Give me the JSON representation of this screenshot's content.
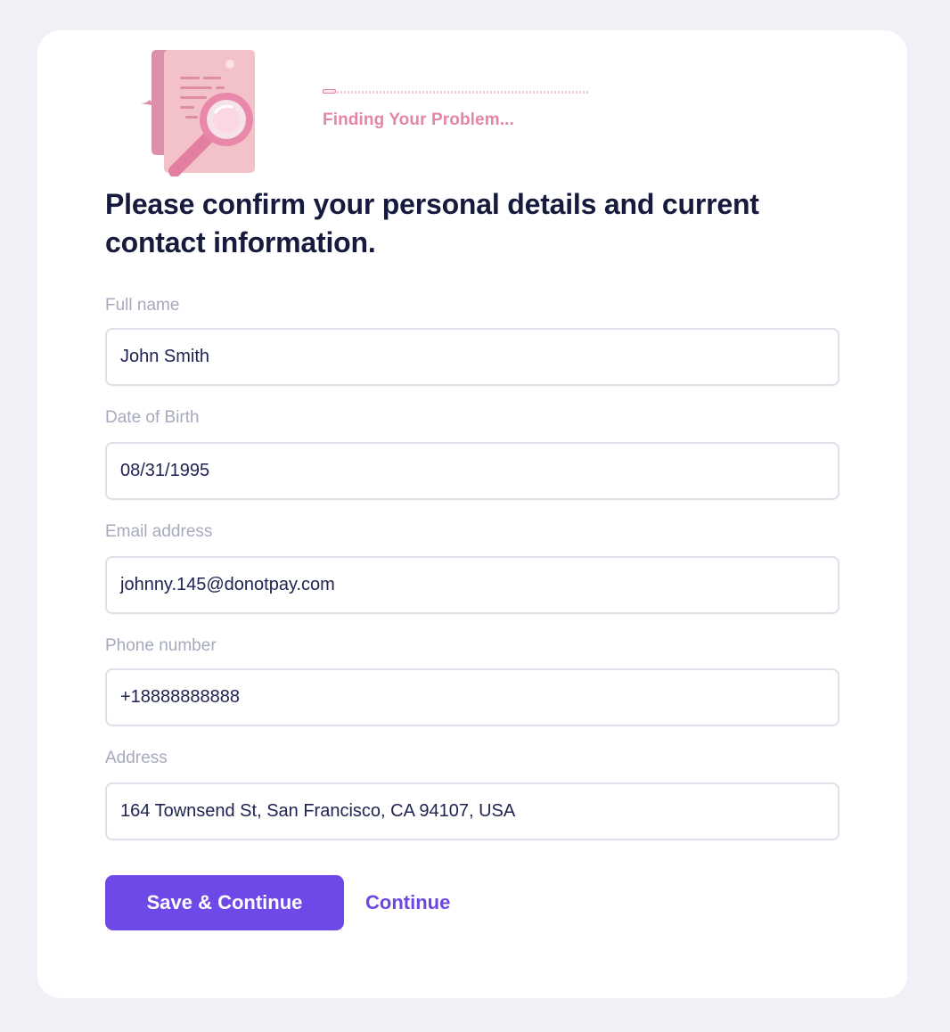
{
  "progress": {
    "label": "Finding Your Problem...",
    "value": 0.05
  },
  "heading": "Please confirm your personal details and current contact information.",
  "form": {
    "fields": [
      {
        "label": "Full name",
        "value": "John Smith"
      },
      {
        "label": "Date of Birth",
        "value": "08/31/1995"
      },
      {
        "label": "Email address",
        "value": "johnny.145@donotpay.com"
      },
      {
        "label": "Phone number",
        "value": "+18888888888"
      },
      {
        "label": "Address",
        "value": "164 Townsend St, San Francisco, CA 94107, USA"
      }
    ]
  },
  "actions": {
    "save_label": "Save & Continue",
    "continue_label": "Continue"
  },
  "colors": {
    "accent": "#6f49e7",
    "progress": "#e77fa1",
    "heading": "#161a3d",
    "background": "#eff1f6"
  },
  "icons": {
    "illustration": "document-magnifier-icon"
  }
}
